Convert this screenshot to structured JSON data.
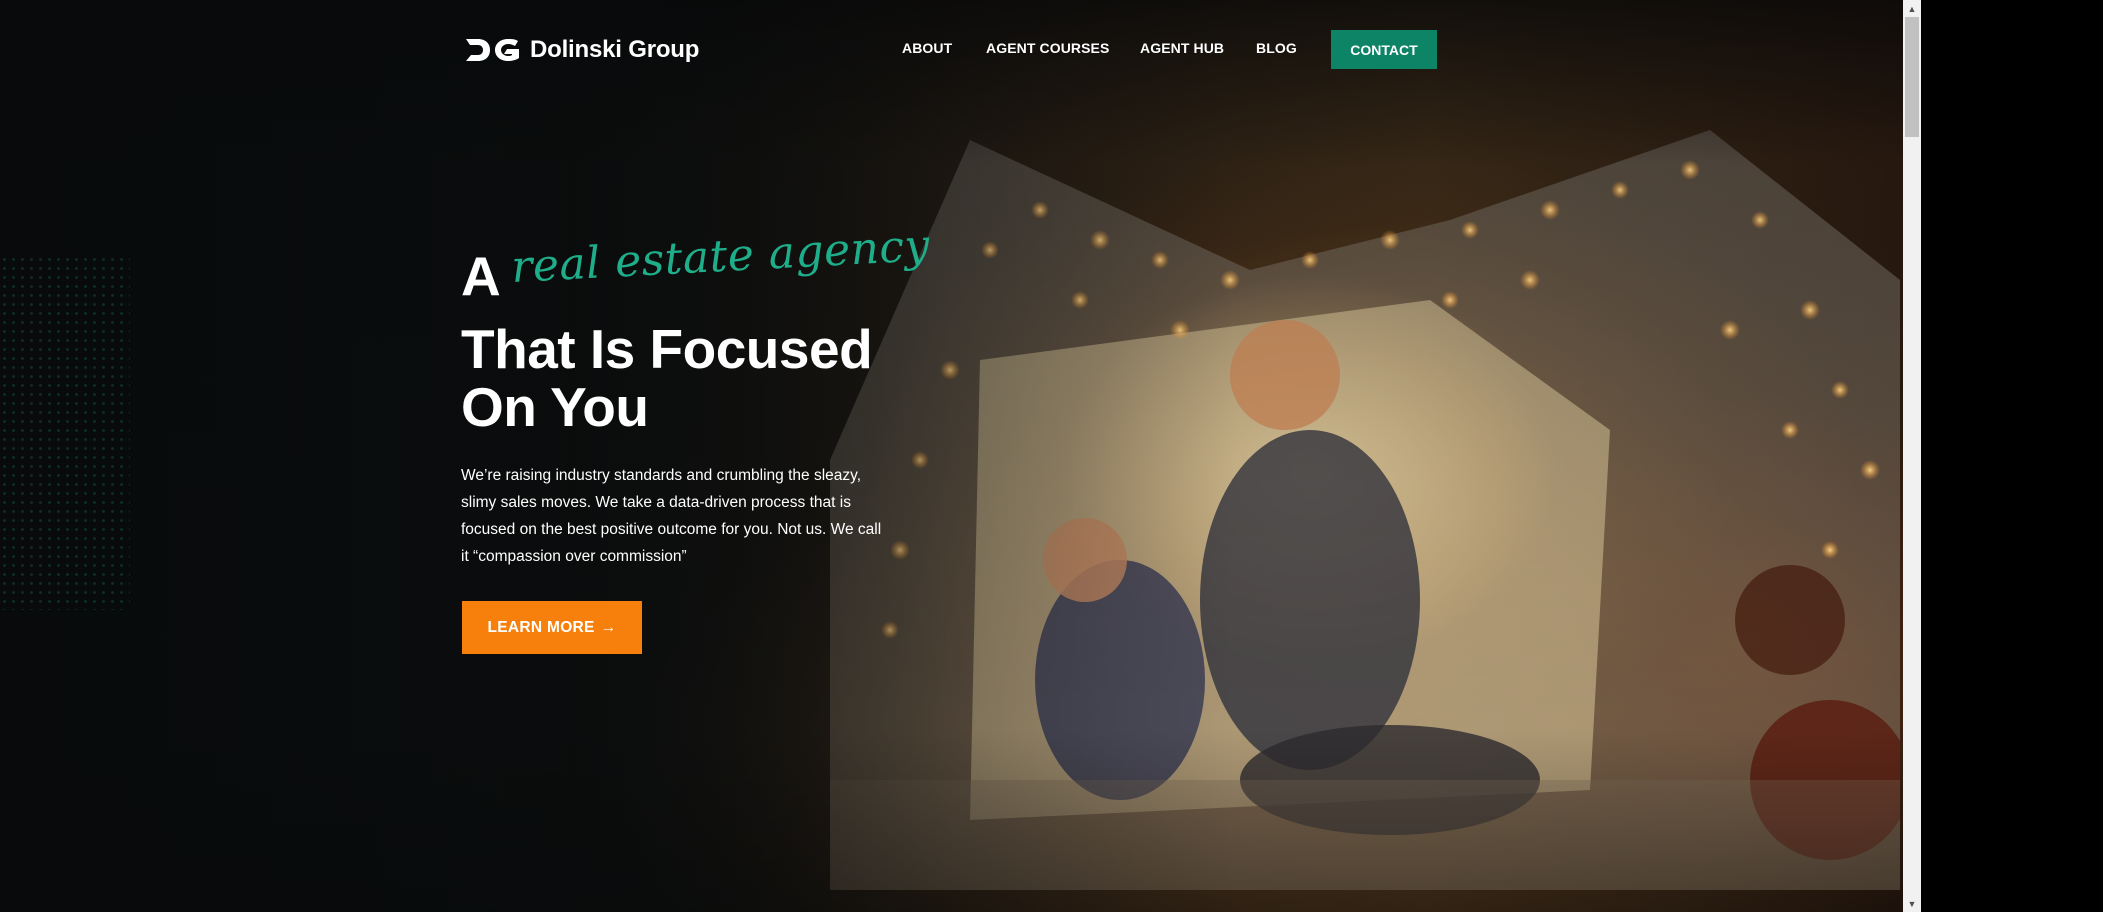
{
  "brand": {
    "name": "Dolinski Group",
    "mark": "DG"
  },
  "nav": {
    "items": [
      "ABOUT",
      "AGENT COURSES",
      "AGENT HUB",
      "BLOG"
    ],
    "contact": "CONTACT"
  },
  "hero": {
    "prefix": "A",
    "script": "real estate agency",
    "title_line1": "That Is Focused",
    "title_line2": "On You",
    "description": "We’re raising industry standards and crumbling the sleazy, slimy sales moves. We take a data-driven process that is focused on the best positive outcome for you. Not us. We call it “compassion over commission”",
    "cta_label": "LEARN MORE",
    "cta_icon": "→"
  },
  "colors": {
    "accent_green": "#0e8466",
    "script_green": "#1fae8a",
    "cta_orange": "#f7800d"
  },
  "icons": {
    "scroll_up": "▲",
    "scroll_down": "▼"
  }
}
